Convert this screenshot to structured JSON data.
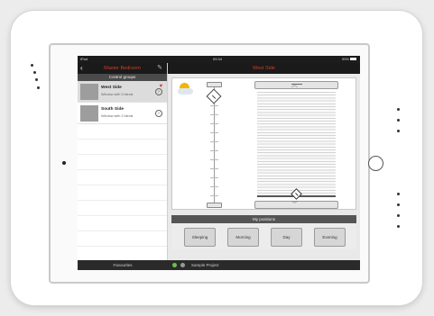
{
  "status": {
    "carrier": "iPad",
    "time": "09:34",
    "battery": "99%"
  },
  "left": {
    "title": "Master Bedroom",
    "section": "Control groups",
    "groups": [
      {
        "name": "West Side",
        "sub": "Window with 3 blinds",
        "selected": true,
        "favorite": true
      },
      {
        "name": "South Side",
        "sub": "Window with 2 blinds",
        "selected": false,
        "favorite": false
      }
    ],
    "footer": "Favourites"
  },
  "right": {
    "title": "West Side",
    "positions_header": "My positions",
    "positions": [
      "Sleeping",
      "Morning",
      "Day",
      "Evening"
    ],
    "project": "Sample Project",
    "status_colors": [
      "#6cc04a",
      "#9a9a9a"
    ],
    "accent": "#d23c2a"
  },
  "icons": {
    "back": "chevron-left-icon",
    "edit": "pencil-icon",
    "weather": "sun-cloud-icon",
    "favorite": "heart-icon"
  }
}
